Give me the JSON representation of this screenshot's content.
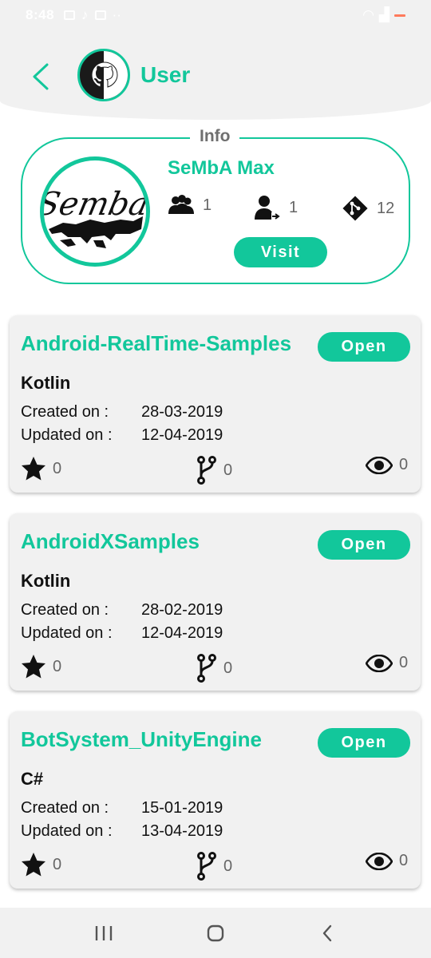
{
  "status_bar": {
    "time": "8:48"
  },
  "header": {
    "title": "User"
  },
  "info": {
    "label": "Info",
    "name": "SeMbA Max",
    "followers": "1",
    "following": "1",
    "repos": "12",
    "visit_label": "Visit",
    "avatar_text": "Semba"
  },
  "repo_labels": {
    "created": "Created on :",
    "updated": "Updated on :"
  },
  "repos": [
    {
      "name": "Android-RealTime-Samples",
      "open_label": "Open",
      "language": "Kotlin",
      "created": "28-03-2019",
      "updated": "12-04-2019",
      "stars": "0",
      "forks": "0",
      "watchers": "0"
    },
    {
      "name": "AndroidXSamples",
      "open_label": "Open",
      "language": "Kotlin",
      "created": "28-02-2019",
      "updated": "12-04-2019",
      "stars": "0",
      "forks": "0",
      "watchers": "0"
    },
    {
      "name": "BotSystem_UnityEngine",
      "open_label": "Open",
      "language": "C#",
      "created": "15-01-2019",
      "updated": "13-04-2019",
      "stars": "0",
      "forks": "0",
      "watchers": "0"
    }
  ],
  "colors": {
    "accent": "#12c79b",
    "card_bg": "#f1f1f1",
    "muted_text": "#666666"
  },
  "icons": [
    "back-arrow-icon",
    "github-icon",
    "followers-icon",
    "following-icon",
    "git-icon",
    "star-icon",
    "fork-icon",
    "eye-icon",
    "recent-apps-icon",
    "home-icon",
    "nav-back-icon"
  ]
}
